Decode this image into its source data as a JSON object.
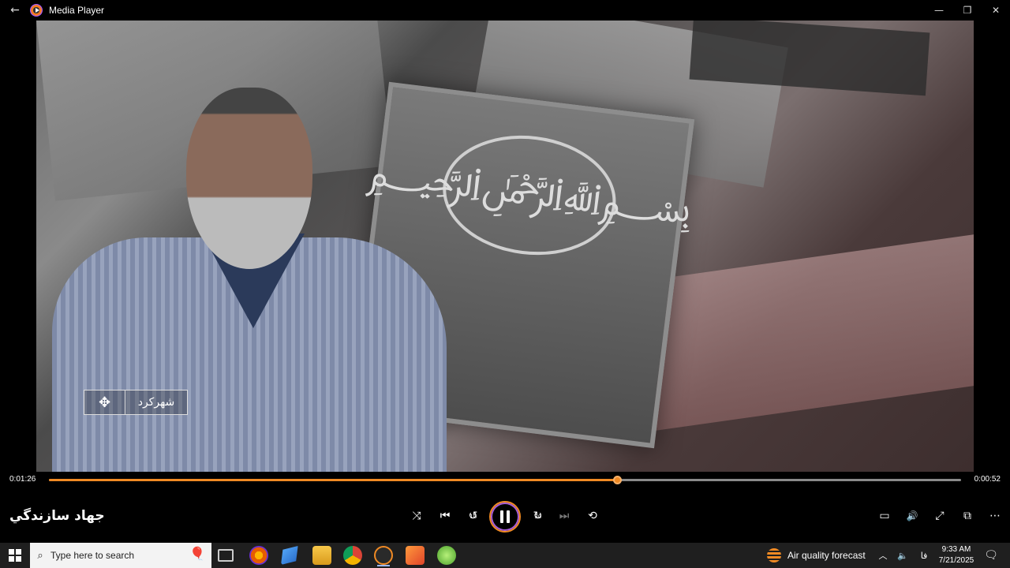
{
  "window": {
    "title": "Media Player",
    "back_icon": "←",
    "minimize_icon": "—",
    "maximize_icon": "❐",
    "close_icon": "✕"
  },
  "video": {
    "channel_logo_text": "شهرکرد",
    "channel_mark": "✥"
  },
  "playback": {
    "elapsed": "0:01:26",
    "remaining": "0:00:52",
    "progress": 0.623,
    "accent_color": "#f08a24"
  },
  "now_playing": {
    "title": "جهاد سازندگي"
  },
  "controls": {
    "shuffle_icon": "⤨",
    "previous_icon": "⏮",
    "rewind_icon": "↺",
    "rewind_label": "10",
    "forward_icon": "↻",
    "forward_label": "30",
    "next_icon": "⏭",
    "repeat_icon": "⟲",
    "captions_icon": "▭",
    "volume_icon": "🔊",
    "fullscreen_icon": "⤢",
    "miniplayer_icon": "⧉",
    "more_icon": "⋯"
  },
  "taskbar": {
    "search_placeholder": "Type here to search",
    "search_icon": "⌕",
    "weather_text": "Air quality forecast",
    "tray_chevron": "︿",
    "volume_icon": "🔈",
    "language": "فا",
    "time": "9:33 AM",
    "date": "7/21/2025",
    "notification_icon": "🗨"
  }
}
